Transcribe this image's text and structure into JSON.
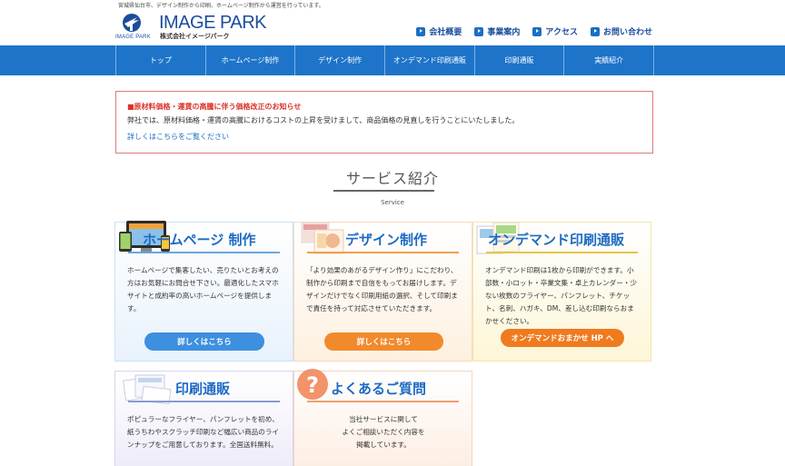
{
  "header": {
    "tagline": "宮城県仙台市、デザイン制作から印刷、ホームページ制作から運営を行っています。",
    "logo_small": "IMAGE PARK",
    "logo_main": "IMAGE PARK",
    "logo_sub": "株式会社イメージパーク",
    "links": [
      "会社概要",
      "事業案内",
      "アクセス",
      "お問い合わせ"
    ]
  },
  "nav": {
    "items": [
      "トップ",
      "ホームページ制作",
      "デザイン制作",
      "オンデマンド印刷通販",
      "印刷通販",
      "実績紹介"
    ]
  },
  "notice": {
    "title": "■原材料価格・運賃の高騰に伴う価格改正のお知らせ",
    "text": "弊社では、原材料価格・運賃の高騰におけるコストの上昇を受けまして、商品価格の見直しを行うことにいたしました。",
    "link": "詳しくはこちらをご覧ください"
  },
  "services": {
    "title": "サービス紹介",
    "subtitle": "Service",
    "cards": [
      {
        "title": "ホームページ 制作",
        "body": "ホームページで集客したい、売りたいとお考えの方はお気軽にお問合せ下さい。最適化したスマホサイトと成約率の高いホームページを提供します。",
        "button": "詳しくはこちら"
      },
      {
        "title": "デザイン制作",
        "body": "「より効果のあがるデザイン作り」にこだわり、制作から印刷まで自信をもってお届けします。デザインだけでなく印刷用紙の選択、そして印刷まで責任を持って対応させていただきます。",
        "button": "詳しくはこちら"
      },
      {
        "title": "オンデマンド印刷通販",
        "body": "オンデマンド印刷は1枚から印刷ができます。小部数・小ロット・卒業文集・卓上カレンダー・少ない枚数のフライヤー、パンフレット、チケット、名刺、ハガキ、DM、差し込む印刷ならおまかせください。",
        "button": "オンデマンドおまかせ HP へ"
      },
      {
        "title": "印刷通販",
        "body": "ポピュラーなフライヤー、パンフレットを初め、紙うちわやスクラッチ印刷など幅広い商品のラインナップをご用意しております。全国送料無料。"
      },
      {
        "title": "よくあるご質問",
        "body_lines": [
          "当社サービスに関して",
          "よくご相談いただく内容を",
          "掲載しています。"
        ]
      }
    ]
  },
  "colors": {
    "nav_bg": "#1d74c9",
    "brand_blue": "#1a4d9c",
    "notice_red": "#d9342b",
    "btn_blue": "#3d8fe0",
    "btn_orange": "#f28a2c"
  }
}
